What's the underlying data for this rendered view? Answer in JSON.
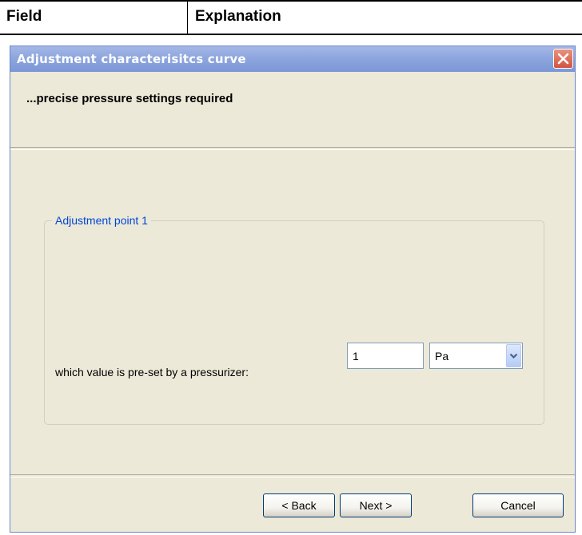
{
  "doc_table": {
    "col1_header": "Field",
    "col2_header": "Explanation"
  },
  "dialog": {
    "title": "Adjustment characterisitcs curve",
    "close_icon": "close-icon",
    "header_text": "...precise pressure settings required",
    "group": {
      "legend": "Adjustment point 1",
      "field_label": "which value is pre-set by a pressurizer:",
      "value": "1",
      "unit": "Pa",
      "unit_dropdown_icon": "chevron-down-icon"
    },
    "buttons": {
      "back": "< Back",
      "next": "Next >",
      "cancel": "Cancel"
    }
  },
  "colors": {
    "titlebar": "#8da6de",
    "dialog_bg": "#ece9d8",
    "legend_text": "#0046d5",
    "close_button": "#d0553f"
  }
}
